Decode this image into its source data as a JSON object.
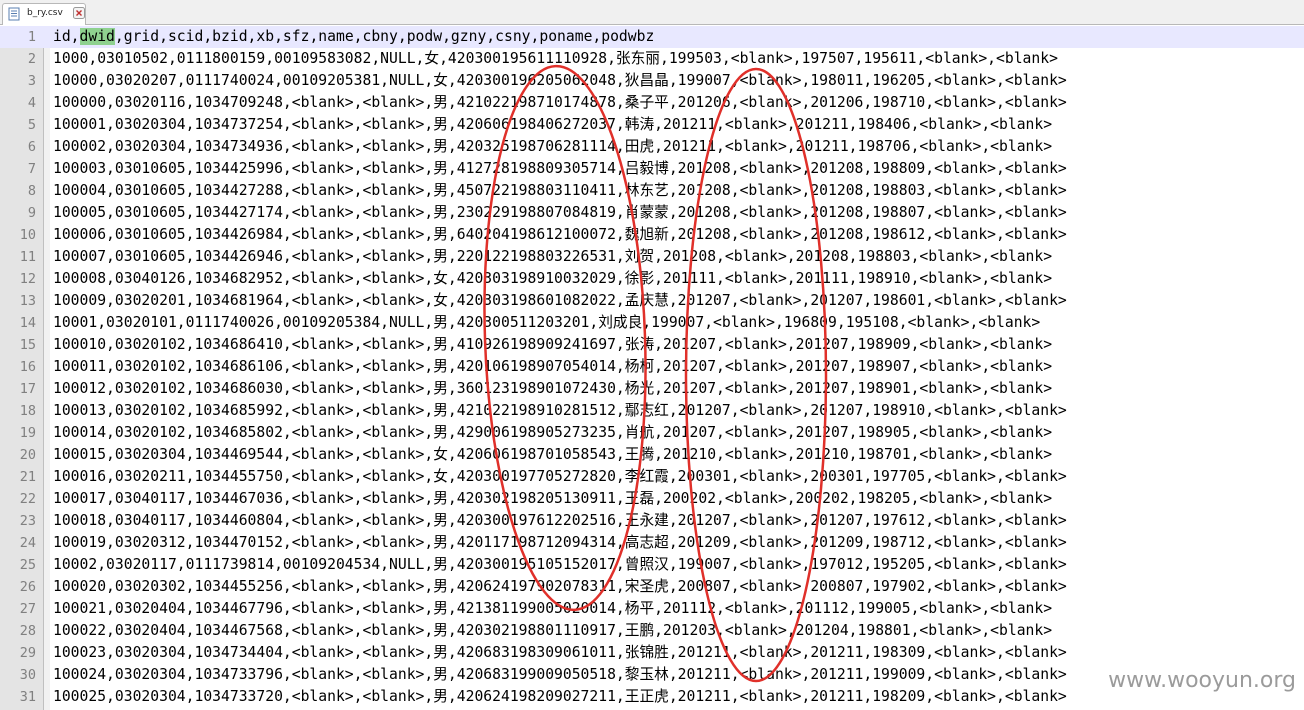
{
  "tab": {
    "title": "b_ry.csv",
    "icon": "notepad-document-icon",
    "close_icon": "tab-close-icon"
  },
  "highlight_word": "dwid",
  "lines": [
    {
      "n": "1",
      "text": "id,dwid,grid,scid,bzid,xb,sfz,name,cbny,podw,gzny,csny,poname,podwbz"
    },
    {
      "n": "2",
      "text": "1000,03010502,0111800159,00109583082,NULL,女,420300195611110928,张东丽,199503,<blank>,197507,195611,<blank>,<blank>"
    },
    {
      "n": "3",
      "text": "10000,03020207,0111740024,00109205381,NULL,女,420300196205062048,狄昌晶,199007,<blank>,198011,196205,<blank>,<blank>"
    },
    {
      "n": "4",
      "text": "100000,03020116,1034709248,<blank>,<blank>,男,421022198710174878,桑子平,201206,<blank>,201206,198710,<blank>,<blank>"
    },
    {
      "n": "5",
      "text": "100001,03020304,1034737254,<blank>,<blank>,男,420606198406272037,韩涛,201211,<blank>,201211,198406,<blank>,<blank>"
    },
    {
      "n": "6",
      "text": "100002,03020304,1034734936,<blank>,<blank>,男,420325198706281114,田虎,201211,<blank>,201211,198706,<blank>,<blank>"
    },
    {
      "n": "7",
      "text": "100003,03010605,1034425996,<blank>,<blank>,男,412728198809305714,吕毅博,201208,<blank>,201208,198809,<blank>,<blank>"
    },
    {
      "n": "8",
      "text": "100004,03010605,1034427288,<blank>,<blank>,男,450722198803110411,林东艺,201208,<blank>,201208,198803,<blank>,<blank>"
    },
    {
      "n": "9",
      "text": "100005,03010605,1034427174,<blank>,<blank>,男,230229198807084819,肖蒙蒙,201208,<blank>,201208,198807,<blank>,<blank>"
    },
    {
      "n": "10",
      "text": "100006,03010605,1034426984,<blank>,<blank>,男,640204198612100072,魏旭新,201208,<blank>,201208,198612,<blank>,<blank>"
    },
    {
      "n": "11",
      "text": "100007,03010605,1034426946,<blank>,<blank>,男,220122198803226531,刘贺,201208,<blank>,201208,198803,<blank>,<blank>"
    },
    {
      "n": "12",
      "text": "100008,03040126,1034682952,<blank>,<blank>,女,420303198910032029,徐影,201111,<blank>,201111,198910,<blank>,<blank>"
    },
    {
      "n": "13",
      "text": "100009,03020201,1034681964,<blank>,<blank>,女,420303198601082022,孟庆慧,201207,<blank>,201207,198601,<blank>,<blank>"
    },
    {
      "n": "14",
      "text": "10001,03020101,0111740026,00109205384,NULL,男,420300511203201,刘成良,199007,<blank>,196809,195108,<blank>,<blank>"
    },
    {
      "n": "15",
      "text": "100010,03020102,1034686410,<blank>,<blank>,男,410926198909241697,张涛,201207,<blank>,201207,198909,<blank>,<blank>"
    },
    {
      "n": "16",
      "text": "100011,03020102,1034686106,<blank>,<blank>,男,420106198907054014,杨柯,201207,<blank>,201207,198907,<blank>,<blank>"
    },
    {
      "n": "17",
      "text": "100012,03020102,1034686030,<blank>,<blank>,男,360123198901072430,杨光,201207,<blank>,201207,198901,<blank>,<blank>"
    },
    {
      "n": "18",
      "text": "100013,03020102,1034685992,<blank>,<blank>,男,421022198910281512,鄢志红,201207,<blank>,201207,198910,<blank>,<blank>"
    },
    {
      "n": "19",
      "text": "100014,03020102,1034685802,<blank>,<blank>,男,429006198905273235,肖航,201207,<blank>,201207,198905,<blank>,<blank>"
    },
    {
      "n": "20",
      "text": "100015,03020304,1034469544,<blank>,<blank>,女,420606198701058543,王腾,201210,<blank>,201210,198701,<blank>,<blank>"
    },
    {
      "n": "21",
      "text": "100016,03020211,1034455750,<blank>,<blank>,女,420300197705272820,李红霞,200301,<blank>,200301,197705,<blank>,<blank>"
    },
    {
      "n": "22",
      "text": "100017,03040117,1034467036,<blank>,<blank>,男,420302198205130911,王磊,200202,<blank>,200202,198205,<blank>,<blank>"
    },
    {
      "n": "23",
      "text": "100018,03040117,1034460804,<blank>,<blank>,男,420300197612202516,王永建,201207,<blank>,201207,197612,<blank>,<blank>"
    },
    {
      "n": "24",
      "text": "100019,03020312,1034470152,<blank>,<blank>,男,420117198712094314,高志超,201209,<blank>,201209,198712,<blank>,<blank>"
    },
    {
      "n": "25",
      "text": "10002,03020117,0111739814,00109204534,NULL,男,420300195105152017,曾照汉,199007,<blank>,197012,195205,<blank>,<blank>"
    },
    {
      "n": "26",
      "text": "100020,03020302,1034455256,<blank>,<blank>,男,420624197902078311,宋圣虎,200807,<blank>,200807,197902,<blank>,<blank>"
    },
    {
      "n": "27",
      "text": "100021,03020404,1034467796,<blank>,<blank>,男,421381199005020014,杨平,201112,<blank>,201112,199005,<blank>,<blank>"
    },
    {
      "n": "28",
      "text": "100022,03020404,1034467568,<blank>,<blank>,男,420302198801110917,王鹏,201203,<blank>,201204,198801,<blank>,<blank>"
    },
    {
      "n": "29",
      "text": "100023,03020304,1034734404,<blank>,<blank>,男,420683198309061011,张锦胜,201211,<blank>,201211,198309,<blank>,<blank>"
    },
    {
      "n": "30",
      "text": "100024,03020304,1034733796,<blank>,<blank>,男,420683199009050518,黎玉林,201211,<blank>,201211,199009,<blank>,<blank>"
    },
    {
      "n": "31",
      "text": "100025,03020304,1034733720,<blank>,<blank>,男,420624198209027211,王正虎,201211,<blank>,201211,198209,<blank>,<blank>"
    }
  ],
  "annotation_color": "#e0302a",
  "watermark": "www.wooyun.org"
}
